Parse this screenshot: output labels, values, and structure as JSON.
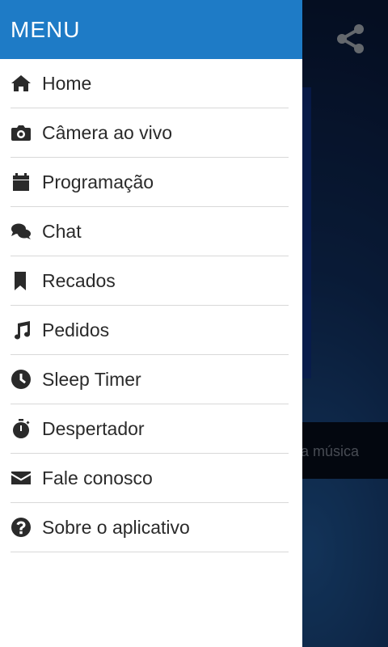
{
  "drawer": {
    "title": "MENU",
    "items": [
      {
        "label": "Home",
        "icon": "home-icon"
      },
      {
        "label": "Câmera ao vivo",
        "icon": "camera-icon"
      },
      {
        "label": "Programação",
        "icon": "calendar-icon"
      },
      {
        "label": "Chat",
        "icon": "chat-icon"
      },
      {
        "label": "Recados",
        "icon": "bookmark-icon"
      },
      {
        "label": "Pedidos",
        "icon": "music-icon"
      },
      {
        "label": "Sleep Timer",
        "icon": "clock-icon"
      },
      {
        "label": "Despertador",
        "icon": "stopwatch-icon"
      },
      {
        "label": "Fale conosco",
        "icon": "envelope-icon"
      },
      {
        "label": "Sobre o aplicativo",
        "icon": "question-circle-icon"
      }
    ]
  },
  "background": {
    "now_playing_text": "a música",
    "share_icon": "share-icon"
  },
  "colors": {
    "header": "#1e7bc6",
    "text": "#2a2a2a",
    "divider": "#d8d8d8"
  }
}
